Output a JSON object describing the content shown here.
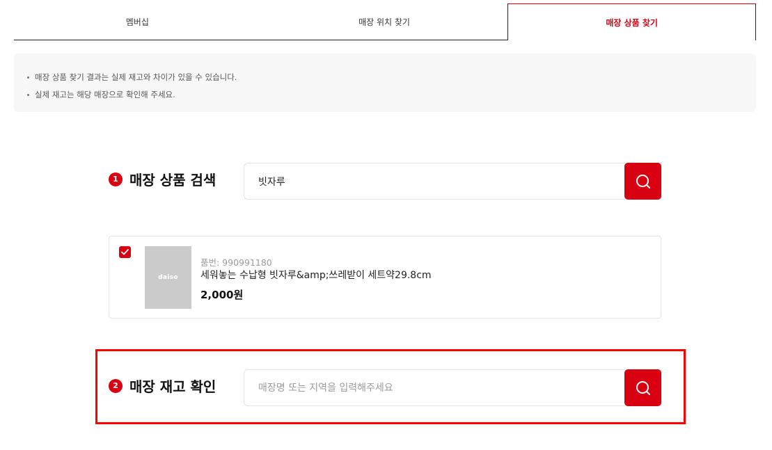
{
  "tabs": [
    {
      "label": "멤버십",
      "active": false
    },
    {
      "label": "매장 위치 찾기",
      "active": false
    },
    {
      "label": "매장 상품 찾기",
      "active": true
    }
  ],
  "notice": {
    "items": [
      "매장 상품 찾기 결과는 실제 재고와 차이가 있을 수 있습니다.",
      "실제 재고는 해당 매장으로 확인해 주세요."
    ]
  },
  "product_search": {
    "step": "1",
    "title": "매장 상품 검색",
    "query_value": "빗자루",
    "button_icon": "search-icon"
  },
  "product": {
    "checked": true,
    "thumbnail_text": "daiso",
    "code_label": "품번: 990991180",
    "name": "세워놓는 수납형 빗자루&amp;쓰레받이 세트약29.8cm",
    "price": "2,000원"
  },
  "stock_check": {
    "step": "2",
    "title": "매장 재고 확인",
    "input_value": "",
    "input_placeholder": "매장명 또는 지역을 입력해주세요",
    "button_icon": "search-icon"
  },
  "colors": {
    "accent": "#d90012",
    "highlight": "#ff0000",
    "notice_bg": "#f7f7f7"
  }
}
